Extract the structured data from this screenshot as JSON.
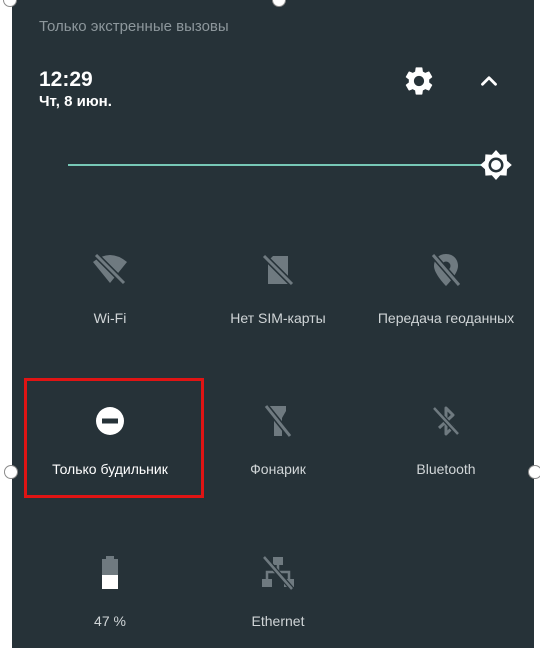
{
  "header": {
    "carrier_text": "Только экстренные вызовы",
    "time": "12:29",
    "date": "Чт, 8 июн."
  },
  "icons": {
    "settings": "gear-icon",
    "collapse": "chevron-up-icon",
    "brightness": "brightness-icon"
  },
  "brightness": {
    "level": 1.0
  },
  "tiles": [
    {
      "label": "Wi-Fi",
      "icon": "wifi-off-icon"
    },
    {
      "label": "Нет SIM-карты",
      "icon": "no-sim-icon"
    },
    {
      "label": "Передача геоданных",
      "icon": "location-off-icon"
    },
    {
      "label": "Только будильник",
      "icon": "do-not-disturb-icon",
      "active": true
    },
    {
      "label": "Фонарик",
      "icon": "flashlight-off-icon"
    },
    {
      "label": "Bluetooth",
      "icon": "bluetooth-off-icon"
    },
    {
      "label": "47 %",
      "icon": "battery-icon"
    },
    {
      "label": "Ethernet",
      "icon": "ethernet-off-icon"
    }
  ],
  "colors": {
    "panel_bg": "#263238",
    "accent": "#77c8b6",
    "highlight": "#e01414",
    "icon_inactive": "#6f7a80",
    "icon_active": "#ffffff"
  }
}
